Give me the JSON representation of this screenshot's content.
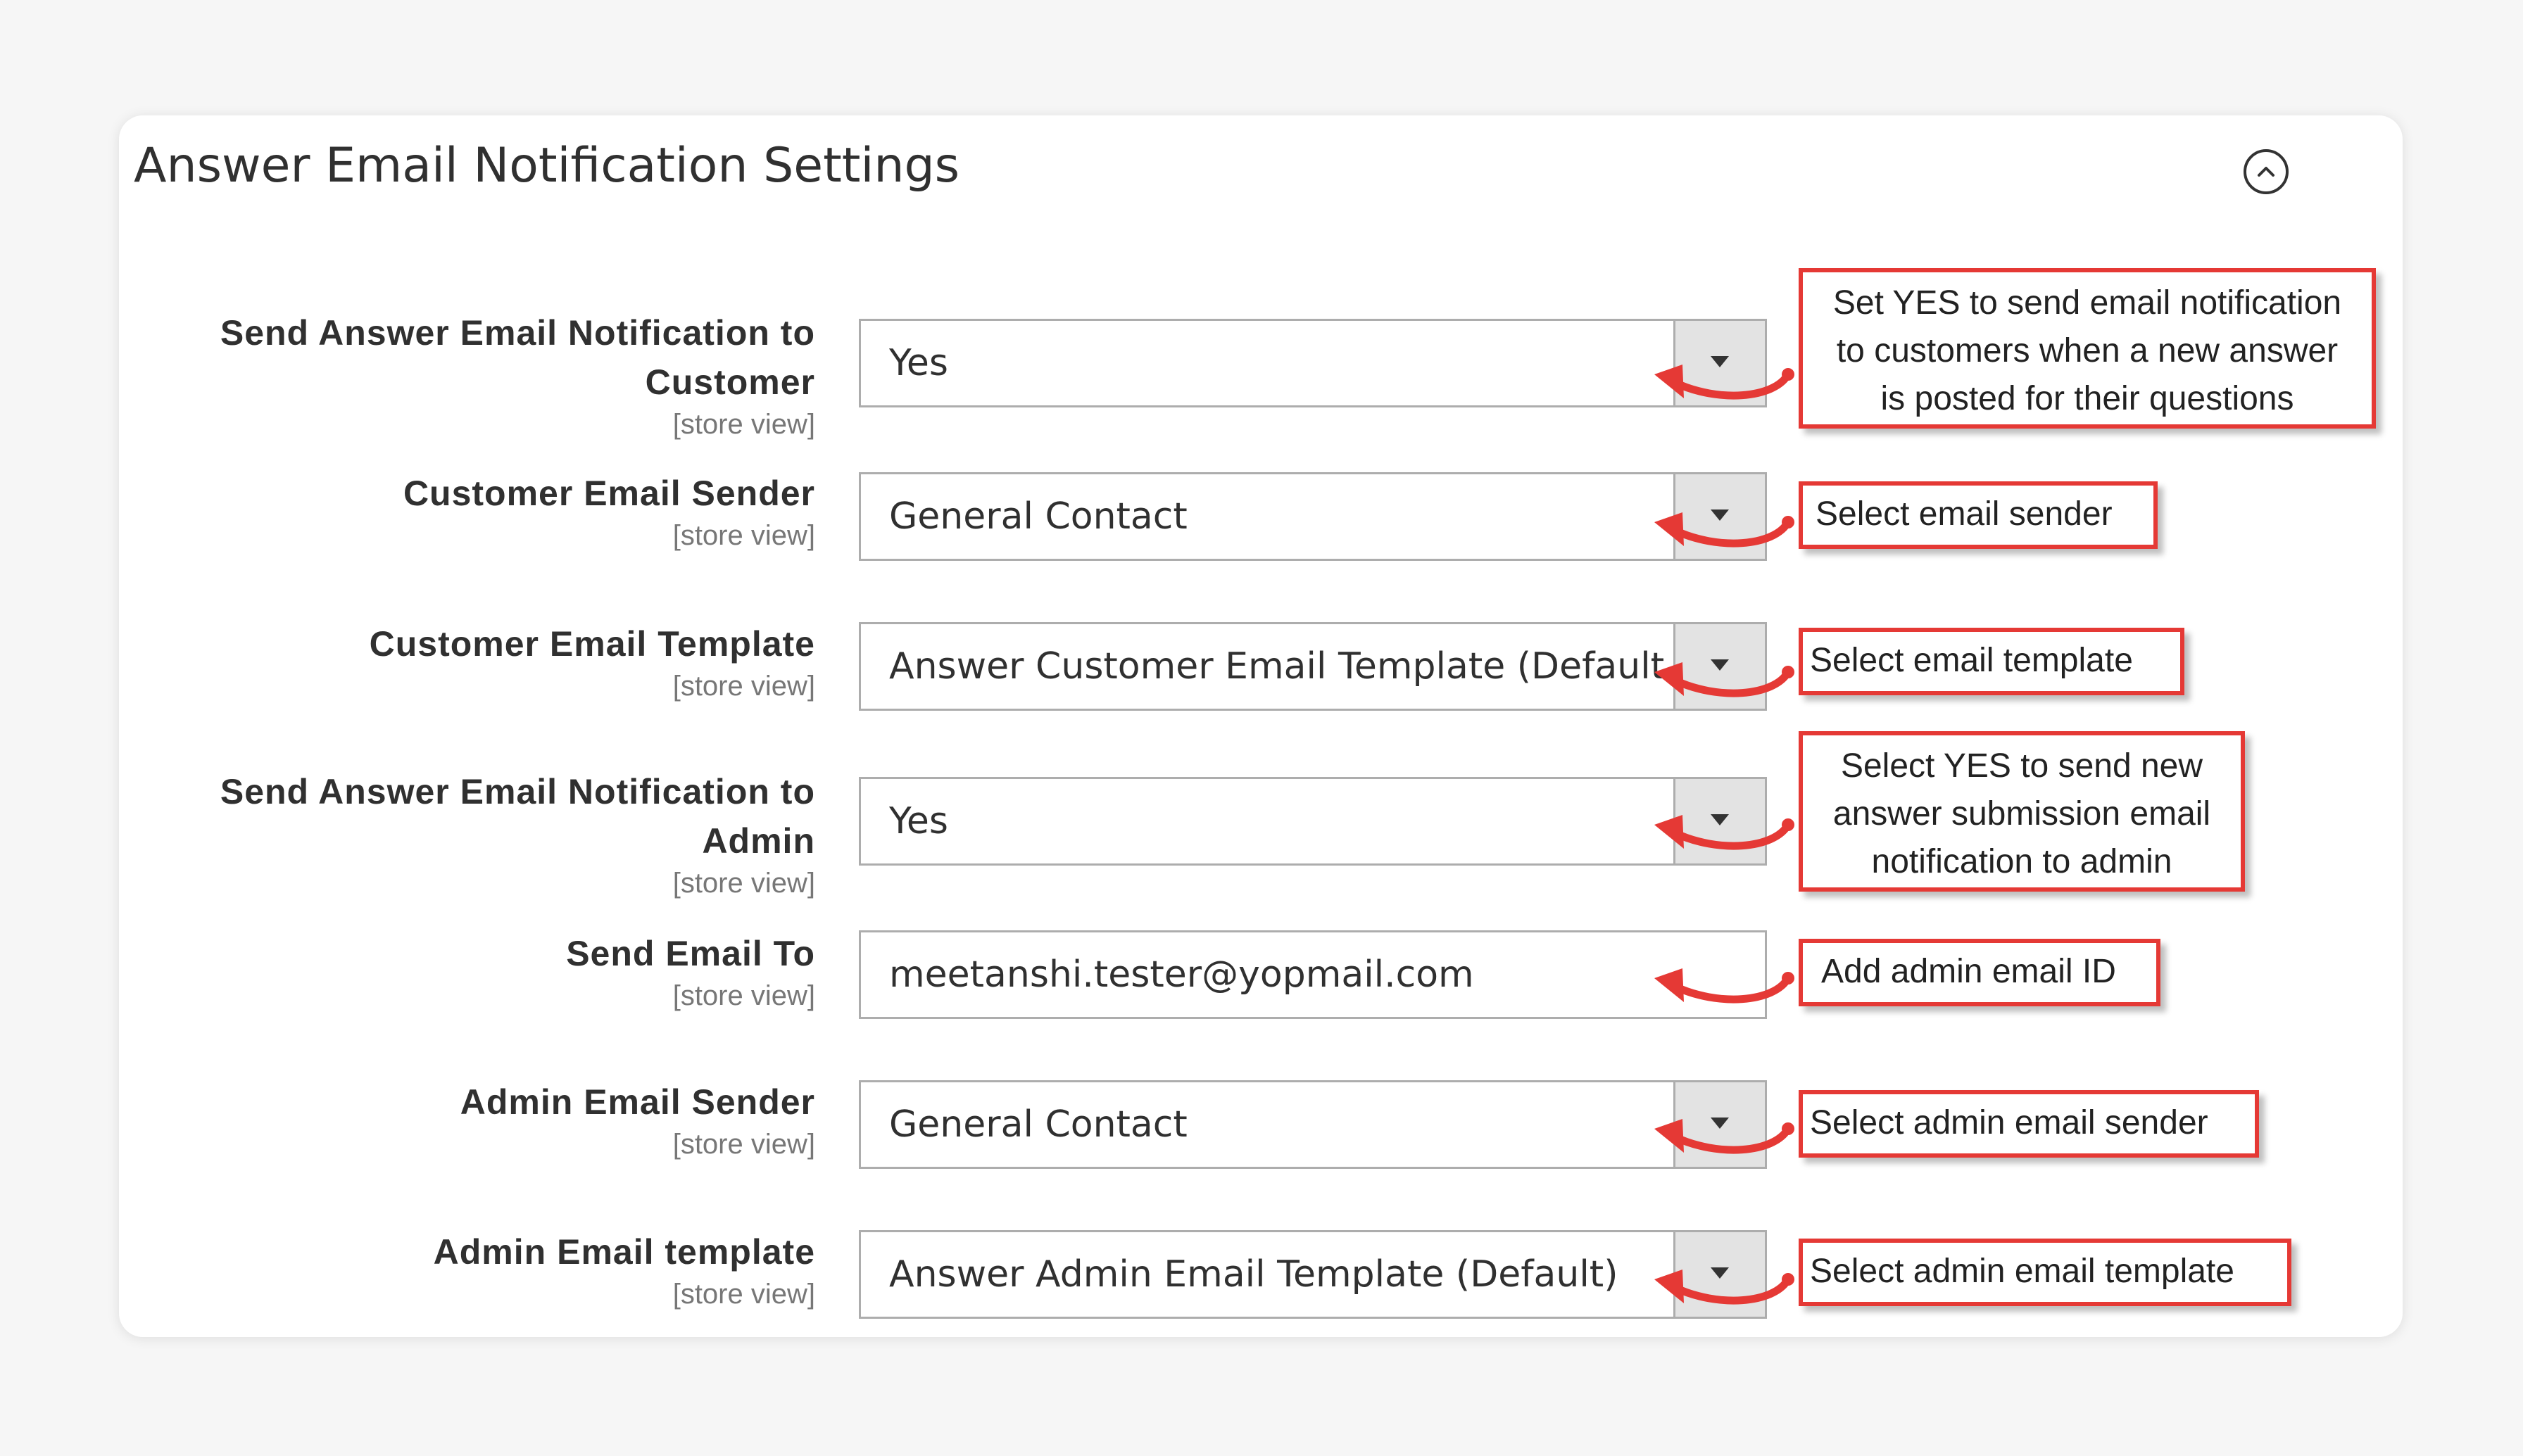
{
  "section": {
    "title": "Answer Email Notification Settings"
  },
  "scope_label": "[store view]",
  "fields": [
    {
      "label_lines": [
        "Send Answer Email Notification to",
        "Customer"
      ],
      "value": "Yes",
      "type": "select"
    },
    {
      "label_lines": [
        "Customer Email Sender"
      ],
      "value": "General Contact",
      "type": "select"
    },
    {
      "label_lines": [
        "Customer Email Template"
      ],
      "value": "Answer Customer Email Template (Default",
      "type": "select"
    },
    {
      "label_lines": [
        "Send Answer Email Notification to",
        "Admin"
      ],
      "value": "Yes",
      "type": "select"
    },
    {
      "label_lines": [
        "Send Email To"
      ],
      "value": "meetanshi.tester@yopmail.com",
      "type": "text"
    },
    {
      "label_lines": [
        "Admin Email Sender"
      ],
      "value": "General Contact",
      "type": "select"
    },
    {
      "label_lines": [
        "Admin Email template"
      ],
      "value": "Answer Admin Email Template (Default)",
      "type": "select"
    }
  ],
  "annotations": [
    {
      "lines": [
        "Set YES to send email notification",
        "to customers when a new answer",
        "is posted for their questions"
      ]
    },
    {
      "lines": [
        "Select email sender"
      ]
    },
    {
      "lines": [
        "Select email template"
      ]
    },
    {
      "lines": [
        "Select YES to send new",
        "answer submission email",
        "notification to admin"
      ]
    },
    {
      "lines": [
        "Add admin email ID"
      ]
    },
    {
      "lines": [
        "Select admin email sender"
      ]
    },
    {
      "lines": [
        "Select admin email template"
      ]
    }
  ],
  "colors": {
    "annotation_red": "#e53935",
    "field_border": "#adadad",
    "dropdown_bg": "#e3e3e3"
  },
  "icons": {
    "collapse": "chevron-up-circle-icon",
    "dropdown": "caret-down-icon",
    "arrow": "curved-arrow-icon"
  }
}
